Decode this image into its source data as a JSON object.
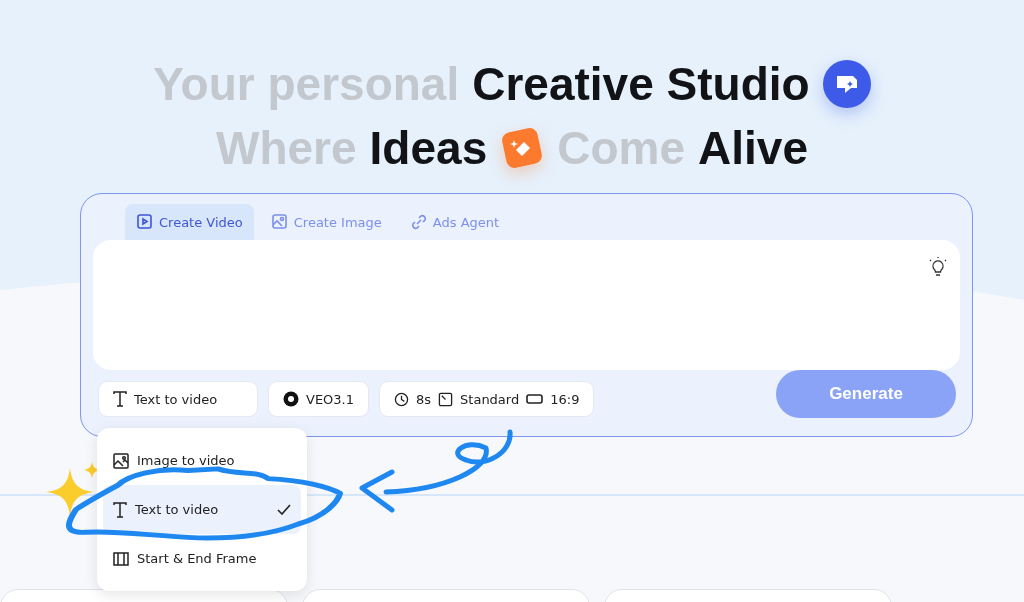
{
  "headline": [
    {
      "line": [
        {
          "text": "Your personal",
          "dark": false
        },
        {
          "text": "Creative Studio",
          "dark": true
        }
      ]
    },
    {
      "line": [
        {
          "text": "Where",
          "dark": false
        },
        {
          "text": "Ideas",
          "dark": true
        },
        {
          "text": "Come",
          "dark": false
        },
        {
          "text": "Alive",
          "dark": true
        }
      ]
    }
  ],
  "tabs": [
    {
      "label": "Create Video",
      "selected": true
    },
    {
      "label": "Create Image",
      "selected": false
    },
    {
      "label": "Ads Agent",
      "selected": false
    }
  ],
  "options": [
    {
      "kind": "mode",
      "label": "Text to video"
    },
    {
      "kind": "model",
      "label": "VEO3.1"
    },
    {
      "kind": "settings",
      "duration": "8s",
      "quality": "Standard",
      "ratio": "16:9"
    }
  ],
  "generate": {
    "label": "Generate",
    "disabled": true
  },
  "menu": [
    {
      "label": "Image to video",
      "selected": false
    },
    {
      "label": "Text to video",
      "selected": true
    },
    {
      "label": "Start & End Frame",
      "selected": false
    }
  ]
}
